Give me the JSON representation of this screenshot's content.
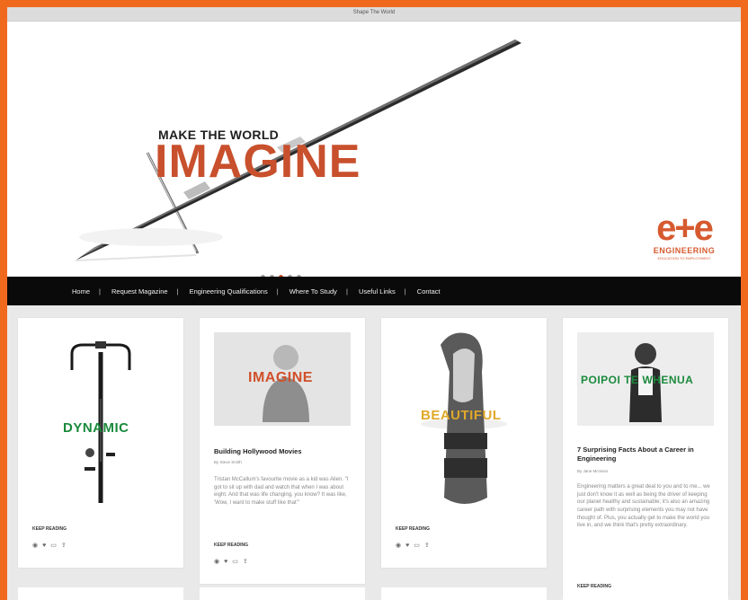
{
  "window": {
    "title": "Shape The World"
  },
  "hero": {
    "kicker": "MAKE THE WORLD",
    "headline": "IMAGINE",
    "logo": {
      "mark": "e+e",
      "word": "ENGINEERING",
      "sub": "EDUCATION TO EMPLOYMENT"
    },
    "slide_count": 5,
    "active_slide": 3
  },
  "nav": {
    "items": [
      {
        "label": "Home"
      },
      {
        "label": "Request Magazine"
      },
      {
        "label": "Engineering Qualifications"
      },
      {
        "label": "Where To Study"
      },
      {
        "label": "Useful Links"
      },
      {
        "label": "Contact"
      }
    ]
  },
  "cards": [
    {
      "overlay": "DYNAMIC",
      "overlay_color": "#1a8a3c",
      "keep_reading": "KEEP READING"
    },
    {
      "overlay": "IMAGINE",
      "overlay_color": "#d0502a",
      "title": "Building Hollywood Movies",
      "byline": "By Steve Smith",
      "excerpt": "Tristan McCallum's favourite movie as a kid was Alien. \"I got to sit up with dad and watch that when I was about eight. And that was life changing, you know? It was like, 'Wow, I want to make stuff like that'\"",
      "keep_reading": "KEEP READING"
    },
    {
      "overlay": "BEAUTIFUL",
      "overlay_color": "#e0a82a",
      "keep_reading": "KEEP READING"
    },
    {
      "overlay": "POIPOI TE WHENUA",
      "overlay_color": "#1a8a3c",
      "title": "7 Surprising Facts About a Career in Engineering",
      "byline": "By Jane Mcniven",
      "excerpt": "Engineering matters a great deal to you and to me... we just don't know it as well as being the driver of keeping our planet healthy and sustainable; it's also an amazing career path with surprising elements you may not have thought of. Plus, you actually get to make the world you live in, and we think that's pretty extraordinary.",
      "keep_reading": "KEEP READING"
    }
  ],
  "card_icons": [
    "eye-icon",
    "heart-icon",
    "comment-icon",
    "share-icon"
  ]
}
